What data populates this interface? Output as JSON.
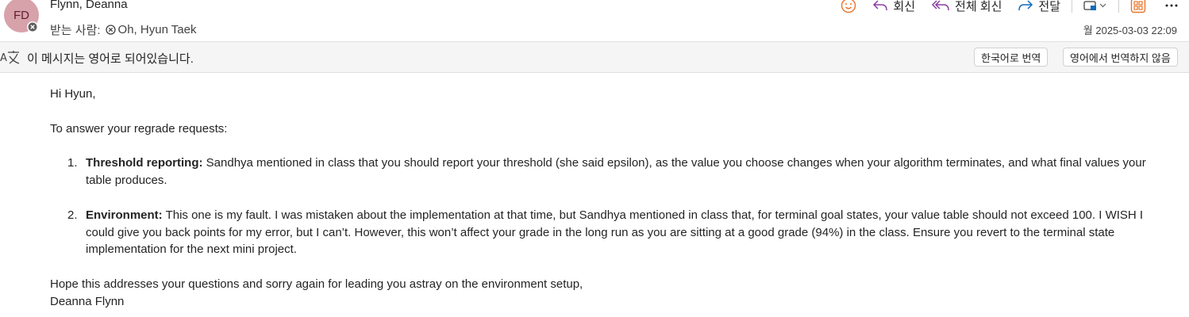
{
  "header": {
    "avatar_initials": "FD",
    "sender_name": "Flynn, Deanna",
    "recipient_label": "받는 사람:",
    "recipient_name": "Oh, Hyun Taek",
    "timestamp": "월 2025-03-03 22:09"
  },
  "toolbar": {
    "reply_label": "회신",
    "reply_all_label": "전체 회신",
    "forward_label": "전달"
  },
  "translation": {
    "notice": "이 메시지는 영어로 되어있습니다.",
    "translate_button": "한국어로 번역",
    "never_translate_button": "영어에서 번역하지 않음"
  },
  "body": {
    "greeting": "Hi Hyun,",
    "intro": "To answer your regrade requests:",
    "items": [
      {
        "number": "1.",
        "title": "Threshold reporting:",
        "text": " Sandhya mentioned in class that you should report your threshold (she said epsilon), as the value you choose changes when your algorithm terminates, and what final values your table produces."
      },
      {
        "number": "2.",
        "title": "Environment:",
        "text": " This one is my fault. I was mistaken about the implementation at that time, but Sandhya mentioned in class that, for terminal goal states, your value table should not exceed 100. I WISH I could give you back points for my error, but I can’t. However, this won’t affect your grade in the long run as you are sitting at a good grade (94%) in the class. Ensure you revert to the terminal state implementation for the next mini project."
      }
    ],
    "closing": "Hope this addresses your questions and sorry again for leading you astray on the environment setup,",
    "signature": "Deanna Flynn"
  },
  "colors": {
    "accent_blue": "#0f6cbd",
    "reply_all_purple": "#8a3ea1",
    "emoji_orange": "#e8742b",
    "avatar_bg": "#d8a2ab"
  },
  "icons": [
    "emoji-icon",
    "reply-icon",
    "reply-all-icon",
    "forward-icon",
    "apps-icon",
    "more-icon",
    "translate-icon",
    "presence-blocked-icon"
  ]
}
